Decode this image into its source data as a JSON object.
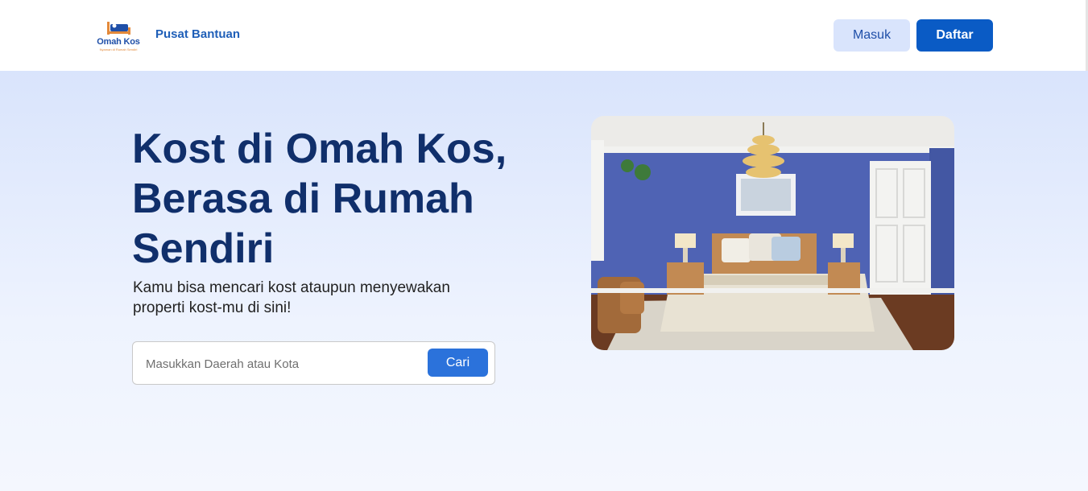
{
  "header": {
    "logo": {
      "text": "Omah Kos",
      "tagline": "Nyaman di Rumah Sendiri",
      "brand_color": "#1f4fa8",
      "accent_color": "#e3893a"
    },
    "help_link": "Pusat Bantuan",
    "login_label": "Masuk",
    "register_label": "Daftar"
  },
  "hero": {
    "title": "Kost di Omah Kos, Berasa di Rumah Sendiri",
    "subtitle": "Kamu bisa mencari kost ataupun menyewakan properti kost-mu di sini!",
    "search": {
      "placeholder": "Masukkan Daerah atau Kota",
      "value": "",
      "button_label": "Cari"
    },
    "image": {
      "icon": "bedroom-photo"
    }
  },
  "colors": {
    "primary": "#0a5bc5",
    "secondary": "#d9e4fc",
    "heading": "#102f6b",
    "search_button": "#2b72db"
  }
}
